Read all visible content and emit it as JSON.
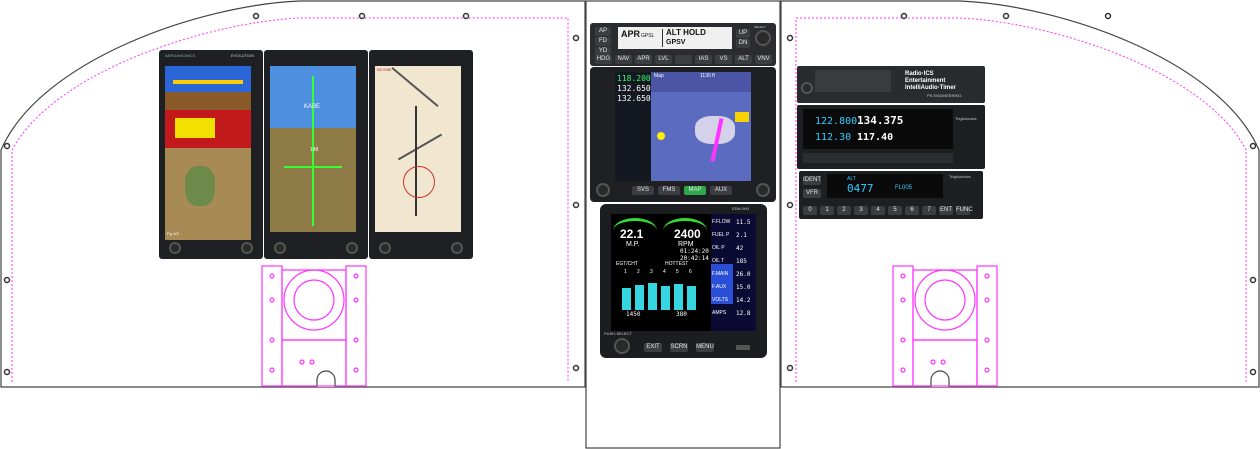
{
  "efis": {
    "brand": "AEROAVIONICS",
    "model": "EVOLUTION",
    "left_text": "Pg 1/3",
    "mid_label": "KABE",
    "mid_alt": "148",
    "right_text": "DCYVB"
  },
  "autopilot": {
    "left_buttons": [
      "AP",
      "FD",
      "YD"
    ],
    "display_left_top": "APR",
    "display_left_sub": "GPSL",
    "display_right_top": "ALT HOLD",
    "display_right_sub": "GPSV",
    "right_buttons": [
      "UP",
      "DN"
    ],
    "select_label": "SELECT",
    "mode_buttons": [
      "HDG",
      "NAV",
      "APR",
      "LVL",
      "",
      "IAS",
      "VS",
      "ALT",
      "VNV"
    ]
  },
  "gtn": {
    "com_freq": "118.200",
    "standby": [
      "132.650",
      "132.650"
    ],
    "map_label": "Map",
    "map_scale": "1130 ft",
    "bottom_buttons": [
      "SVS",
      "FMS",
      "MAP",
      "AUX"
    ]
  },
  "engine": {
    "model": "EDM-900",
    "mp_value": "22.1",
    "mp_label": "M.P.",
    "rpm_value": "2400",
    "rpm_label": "RPM",
    "time1": "01:24:20",
    "time2": "20:42:14",
    "egt_label": "EGT/CHT",
    "hottest_label": "HOTTEST",
    "cylinders": [
      "1",
      "2",
      "3",
      "4",
      "5",
      "6"
    ],
    "bar_values": [
      70,
      78,
      85,
      74,
      80,
      76
    ],
    "readouts": [
      {
        "label": "F.FLOW",
        "value": "11.5"
      },
      {
        "label": "FUEL P",
        "value": "2.1"
      },
      {
        "label": "OIL P",
        "value": "42"
      },
      {
        "label": "OIL T",
        "value": "185"
      },
      {
        "label": "F.MAIN",
        "value": "26.0"
      },
      {
        "label": "F.AUX",
        "value": "15.0"
      },
      {
        "label": "VOLTS",
        "value": "14.2"
      },
      {
        "label": "AMPS",
        "value": "12.8"
      }
    ],
    "egt_value": "1450",
    "cht_value": "380",
    "buttons": [
      "EXIT",
      "SCRN",
      "MENU"
    ],
    "push_select": "PUSH-SELECT"
  },
  "audio": {
    "lines": [
      "Radio·ICS",
      "Entertainment",
      "IntelliAudio·Timer"
    ],
    "brand": "PS ENGINEERING"
  },
  "navcom": {
    "com_active": "122.800",
    "com_standby": "134.375",
    "nav_active": "112.30",
    "nav_standby": "117.40",
    "brand": "TrigAvionics"
  },
  "transponder": {
    "mode_label": "ALT",
    "code": "0477",
    "flight_level": "FL005",
    "brand": "TrigAvionics",
    "ident": "IDENT",
    "vfr": "VFR",
    "keys": [
      "0",
      "1",
      "2",
      "3",
      "4",
      "5",
      "6",
      "7",
      "ENT",
      "FUNC"
    ]
  },
  "colors": {
    "outline": "#444444",
    "cutout": "#ff33ff",
    "bezel": "#1f2023",
    "sky": "#2a66d6",
    "ground": "#8b5a2b"
  }
}
